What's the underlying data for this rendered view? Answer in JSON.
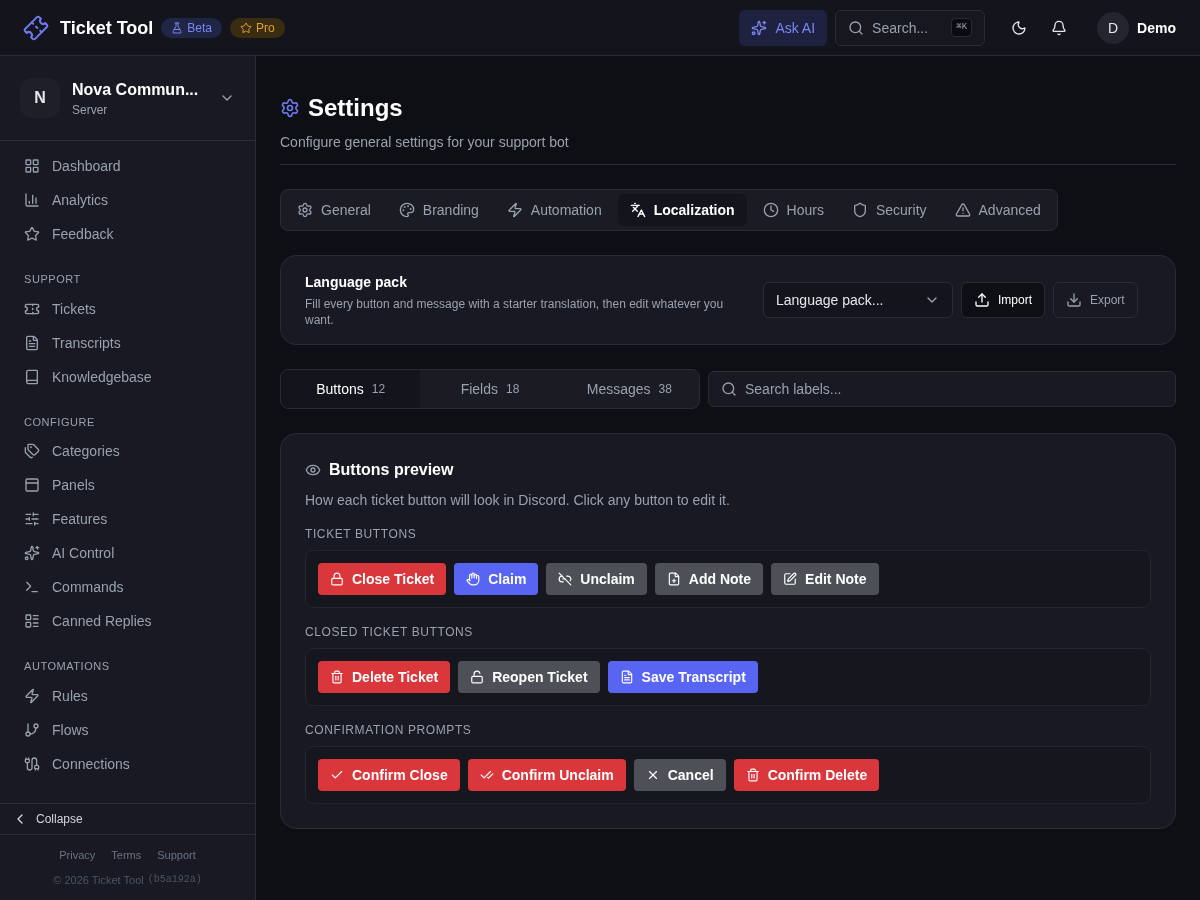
{
  "header": {
    "app_name": "Ticket Tool",
    "badges": [
      {
        "label": "Beta",
        "kind": "beta"
      },
      {
        "label": "Pro",
        "kind": "pro"
      }
    ],
    "ask_ai": "Ask AI",
    "search": {
      "placeholder": "Search...",
      "shortcut": "⌘K"
    },
    "user": {
      "initial": "D",
      "name": "Demo"
    }
  },
  "sidebar": {
    "server": {
      "initial": "N",
      "name": "Nova Commun...",
      "subtitle": "Server"
    },
    "sections": [
      {
        "items": [
          {
            "label": "Dashboard",
            "selected": false
          },
          {
            "label": "Analytics",
            "selected": false
          },
          {
            "label": "Feedback",
            "selected": false
          }
        ]
      },
      {
        "label": "SUPPORT",
        "items": [
          {
            "label": "Tickets",
            "selected": false
          },
          {
            "label": "Transcripts",
            "selected": false
          },
          {
            "label": "Knowledgebase",
            "selected": false
          }
        ]
      },
      {
        "label": "CONFIGURE",
        "items": [
          {
            "label": "Categories",
            "selected": false
          },
          {
            "label": "Panels",
            "selected": false
          },
          {
            "label": "Features",
            "selected": false
          },
          {
            "label": "AI Control",
            "selected": false
          },
          {
            "label": "Commands",
            "selected": false
          },
          {
            "label": "Canned Replies",
            "selected": false
          }
        ]
      },
      {
        "label": "AUTOMATIONS",
        "items": [
          {
            "label": "Rules",
            "selected": false
          },
          {
            "label": "Flows",
            "selected": false
          },
          {
            "label": "Connections",
            "selected": false
          }
        ]
      }
    ],
    "collapse": "Collapse",
    "footer_links": [
      "Privacy",
      "Terms",
      "Support"
    ],
    "copyright": "© 2026 Ticket Tool",
    "build": "(b5a192a)"
  },
  "page": {
    "title": "Settings",
    "subtitle": "Configure general settings for your support bot",
    "tabs": [
      {
        "label": "General",
        "selected": false
      },
      {
        "label": "Branding",
        "selected": false
      },
      {
        "label": "Automation",
        "selected": false
      },
      {
        "label": "Localization",
        "selected": true
      },
      {
        "label": "Hours",
        "selected": false
      },
      {
        "label": "Security",
        "selected": false
      },
      {
        "label": "Advanced",
        "selected": false
      }
    ],
    "language_pack": {
      "title": "Language pack",
      "description": "Fill every button and message with a starter translation, then edit whatever you want.",
      "select": "Language pack...",
      "import": "Import",
      "export": "Export"
    },
    "subtabs": [
      {
        "label": "Buttons",
        "count": "12",
        "selected": true
      },
      {
        "label": "Fields",
        "count": "18",
        "selected": false
      },
      {
        "label": "Messages",
        "count": "38",
        "selected": false
      }
    ],
    "search": {
      "placeholder": "Search labels..."
    },
    "preview": {
      "title": "Buttons preview",
      "description": "How each ticket button will look in Discord. Click any button to edit it.",
      "groups": [
        {
          "label": "TICKET BUTTONS",
          "buttons": [
            {
              "label": "Close Ticket",
              "kind": "danger"
            },
            {
              "label": "Claim",
              "kind": "primary"
            },
            {
              "label": "Unclaim",
              "kind": "secondary"
            },
            {
              "label": "Add Note",
              "kind": "secondary"
            },
            {
              "label": "Edit Note",
              "kind": "secondary"
            }
          ]
        },
        {
          "label": "CLOSED TICKET BUTTONS",
          "buttons": [
            {
              "label": "Delete Ticket",
              "kind": "danger"
            },
            {
              "label": "Reopen Ticket",
              "kind": "secondary"
            },
            {
              "label": "Save Transcript",
              "kind": "primary"
            }
          ]
        },
        {
          "label": "CONFIRMATION PROMPTS",
          "buttons": [
            {
              "label": "Confirm Close",
              "kind": "danger"
            },
            {
              "label": "Confirm Unclaim",
              "kind": "danger"
            },
            {
              "label": "Cancel",
              "kind": "secondary"
            },
            {
              "label": "Confirm Delete",
              "kind": "danger"
            }
          ]
        }
      ]
    }
  }
}
